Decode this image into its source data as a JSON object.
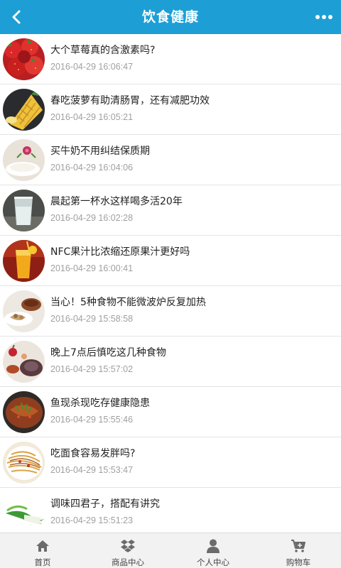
{
  "header": {
    "title": "饮食健康",
    "back_icon": "chevron-left-icon",
    "more_icon": "more-dots-icon"
  },
  "colors": {
    "header_bg": "#1d9fd6",
    "tab_icon": "#6b6b6b"
  },
  "articles": [
    {
      "title": "大个草莓真的含激素吗?",
      "date": "2016-04-29 16:06:47",
      "image": "strawberries"
    },
    {
      "title": "春吃菠萝有助清肠胃，还有减肥功效",
      "date": "2016-04-29 16:05:21",
      "image": "pineapple"
    },
    {
      "title": "买牛奶不用纠结保质期",
      "date": "2016-04-29 16:04:06",
      "image": "milk"
    },
    {
      "title": "晨起第一杯水这样喝多活20年",
      "date": "2016-04-29 16:02:28",
      "image": "glass-of-water"
    },
    {
      "title": "NFC果汁比浓缩还原果汁更好吗",
      "date": "2016-04-29 16:00:41",
      "image": "juice"
    },
    {
      "title": "当心！5种食物不能微波炉反复加热",
      "date": "2016-04-29 15:58:58",
      "image": "food-plate"
    },
    {
      "title": "晚上7点后慎吃这几种食物",
      "date": "2016-04-29 15:57:02",
      "image": "evening-snack"
    },
    {
      "title": "鱼现杀现吃存健康隐患",
      "date": "2016-04-29 15:55:46",
      "image": "fish-dish"
    },
    {
      "title": "吃面食容易发胖吗?",
      "date": "2016-04-29 15:53:47",
      "image": "noodles"
    },
    {
      "title": "调味四君子，搭配有讲究",
      "date": "2016-04-29 15:51:23",
      "image": "scallions"
    }
  ],
  "tabbar": [
    {
      "label": "首页",
      "icon": "home-icon"
    },
    {
      "label": "商品中心",
      "icon": "dropbox-icon"
    },
    {
      "label": "个人中心",
      "icon": "user-icon"
    },
    {
      "label": "购物车",
      "icon": "cart-icon"
    }
  ]
}
